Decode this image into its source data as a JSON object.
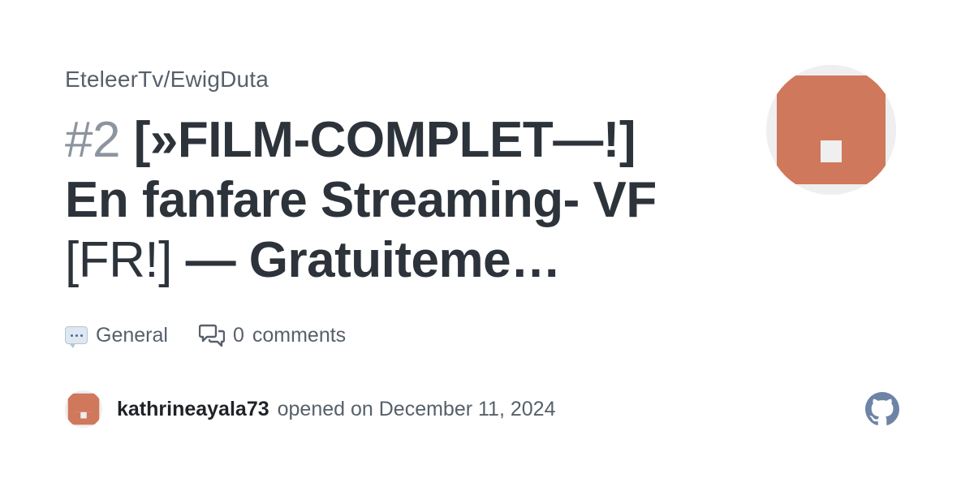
{
  "repo": {
    "path": "EteleerTv/EwigDuta"
  },
  "issue": {
    "number": "#2",
    "title_part1": "[»FILM-COMPLET—!]",
    "title_part2": "En fanfare Streaming-",
    "title_part3_a": "VF",
    "title_part3_b": "[FR!]",
    "title_part3_c": "— Gratuiteme…"
  },
  "meta": {
    "category_icon": "speech-balloon-icon",
    "category_label": "General",
    "comments_icon": "comment-discussion-icon",
    "comments_count": "0",
    "comments_label": "comments"
  },
  "author": {
    "username": "kathrineayala73",
    "opened_text": "opened on December 11, 2024"
  },
  "icons": {
    "brand": "github-mark-icon"
  },
  "colors": {
    "identicon": "#d0785c",
    "identicon_bg": "#efefef",
    "github_icon": "#6e84a6"
  }
}
